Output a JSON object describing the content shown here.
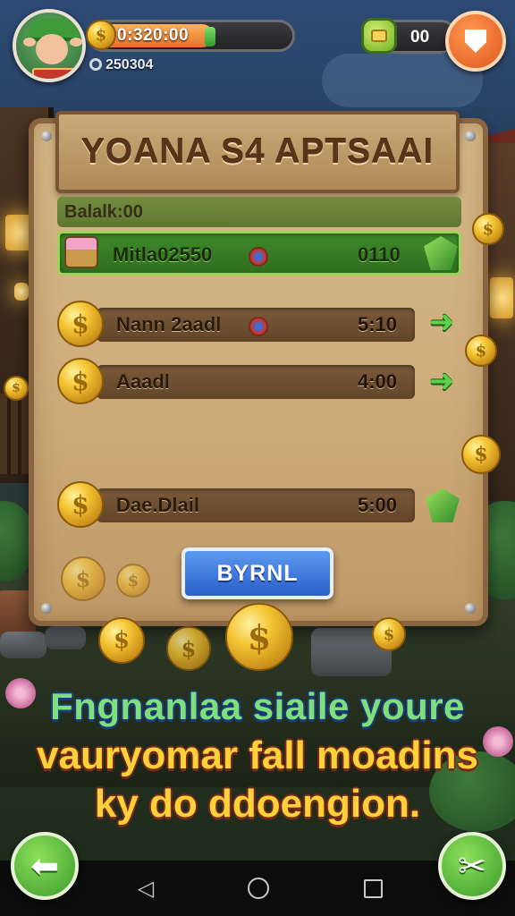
{
  "hud": {
    "coins_value": "0:320:00",
    "coin_bar_fill": 0.6,
    "sub_stat": "250304",
    "gems_value": "00"
  },
  "board": {
    "title": "YOANA S4 APTSAAI",
    "balance_label": "Balalk:00",
    "rows": [
      {
        "name": "Mitla02550",
        "time": "0110",
        "highlighted": true
      },
      {
        "name": "Nann 2aadl",
        "time": "5:10",
        "highlighted": false
      },
      {
        "name": "Aaadl",
        "time": "4:00",
        "highlighted": false
      },
      {
        "name": "Dae.Dlail",
        "time": "5:00",
        "highlighted": false
      }
    ],
    "confirm_label": "BYRNL"
  },
  "caption": {
    "line1": "Fngnanlaa siaile youre",
    "line2": "vauryomar fall moadins",
    "line3": "ky do ddoengion."
  },
  "icons": {
    "coin": "coin-icon",
    "gem": "gem-icon",
    "shield": "shield-icon",
    "back": "back-arrow-icon",
    "tools": "tools-icon"
  },
  "colors": {
    "accent_green": "#3e8a2a",
    "button_blue": "#2a5ec8",
    "caption_green": "#7fe07a",
    "caption_yellow": "#ffd23a"
  }
}
